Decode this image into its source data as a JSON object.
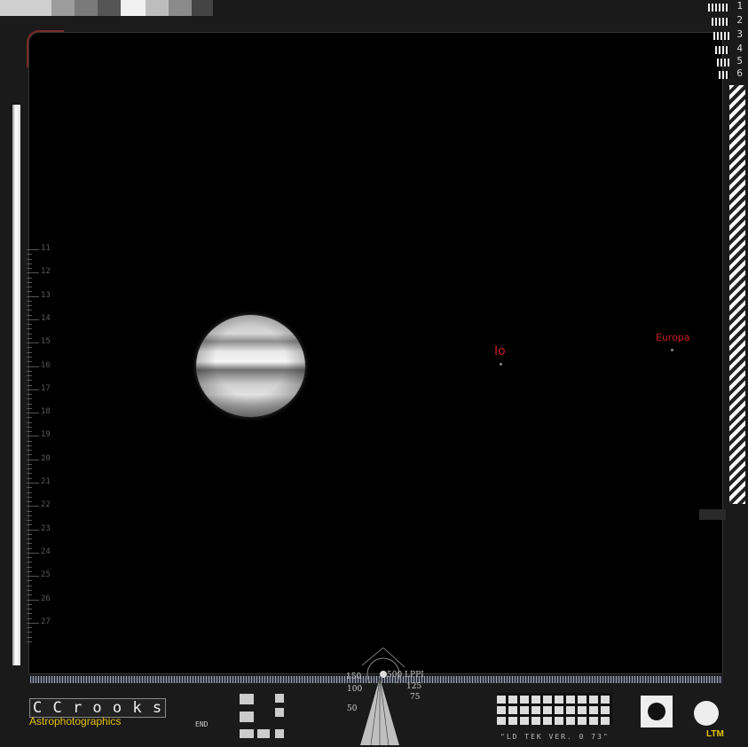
{
  "moons": [
    {
      "label": "Io",
      "color": "#c81d1d"
    },
    {
      "label": "Europa",
      "color": "#c81d1d"
    }
  ],
  "ruler": {
    "labels": [
      "11",
      "12",
      "13",
      "14",
      "15",
      "16",
      "17",
      "18",
      "19",
      "20",
      "21",
      "22",
      "23",
      "24",
      "25",
      "26",
      "27"
    ]
  },
  "resolution_chart": {
    "numbers": [
      "1",
      "2",
      "3",
      "4",
      "5",
      "6"
    ]
  },
  "lppi": {
    "main_label": "500 LPPI",
    "values": [
      "150",
      "125",
      "100",
      "75",
      "50"
    ]
  },
  "logo": {
    "boxes_text": "C C r o o k s",
    "subtitle": "Astrophotographics",
    "accent_color": "#e6c200"
  },
  "footer": {
    "version_label": "\"LD TEK VER. 0 73\"",
    "end_label": "END",
    "ltm_label": "LTM"
  }
}
